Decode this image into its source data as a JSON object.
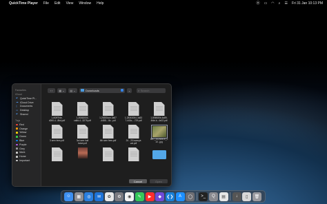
{
  "menubar": {
    "app_name": "QuickTime Player",
    "items": [
      "File",
      "Edit",
      "View",
      "Window",
      "Help"
    ],
    "datetime": "Fri 31 Jan  10:13 PM"
  },
  "dialog": {
    "sidebar": {
      "favourites_label": "Favourites",
      "icloud_label": "iCloud",
      "icloud_items": [
        "QuickTime Pl...",
        "iCloud Drive",
        "Documents",
        "Desktop",
        "Shared"
      ],
      "tags_label": "Tags",
      "tags": [
        {
          "label": "Red",
          "color": "#ff453a"
        },
        {
          "label": "Orange",
          "color": "#ff9f0a"
        },
        {
          "label": "Yellow",
          "color": "#ffd60a"
        },
        {
          "label": "Green",
          "color": "#32d74b"
        },
        {
          "label": "Blue",
          "color": "#0a84ff"
        },
        {
          "label": "Purple",
          "color": "#bf5af2"
        },
        {
          "label": "Grey",
          "color": "#98989d"
        },
        {
          "label": "Work",
          "color": "#d0d0d0"
        },
        {
          "label": "Home",
          "color": "#d0d0d0"
        },
        {
          "label": "Important",
          "color": "#d0d0d0"
        }
      ]
    },
    "location": "Downloads",
    "search_placeholder": "Search",
    "files": [
      {
        "name": "1-6f2ff7f4e-\nd260-4...8bd.pdf",
        "kind": "pdf"
      },
      {
        "name": "1-28363004-\nca8d-4...3278.pdf",
        "kind": "pdf"
      },
      {
        "name": "1-26350cce-3a57\n-4485-...8c...pdf",
        "kind": "pdf"
      },
      {
        "name": "1-28363004-3a53\n7-440c-...729.pdf",
        "kind": "pdf"
      },
      {
        "name": "1-8f3f680b-4a89-\n4fde-b...4e22.pdf",
        "kind": "pdf"
      },
      {
        "name": "3 sem fees.pdf",
        "kind": "pdf"
      },
      {
        "name": "3rd sem hall\nticket.pdf",
        "kind": "pdf"
      },
      {
        "name": "4th sem fees.pdf",
        "kind": "pdf"
      },
      {
        "name": "24 - 25 lavanya\nvat.pdf",
        "kind": "pdf"
      },
      {
        "name": "IMG_20240519_2\n10...jpg",
        "kind": "img"
      },
      {
        "name": "",
        "kind": "pdf"
      },
      {
        "name": "",
        "kind": "img2"
      },
      {
        "name": "",
        "kind": "pdf"
      },
      {
        "name": "",
        "kind": "pdf"
      },
      {
        "name": "",
        "kind": "folder"
      }
    ],
    "cancel_label": "Cancel",
    "open_label": "Open"
  },
  "dock": {
    "apps": [
      {
        "name": "finder-icon",
        "color": "#3d8ff0",
        "glyph": "☺"
      },
      {
        "name": "launchpad-icon",
        "color": "#8e8e93",
        "glyph": "▦"
      },
      {
        "name": "safari-icon",
        "color": "#2a7fe0",
        "glyph": "◎"
      },
      {
        "name": "mail-icon",
        "color": "#1e73d8",
        "glyph": "✉"
      },
      {
        "name": "photos-icon",
        "color": "#e8e8e8",
        "glyph": "✿"
      },
      {
        "name": "settings-icon",
        "color": "#7a7a80",
        "glyph": "⚙"
      },
      {
        "name": "chrome-icon",
        "color": "#f2f2f2",
        "glyph": "◉"
      },
      {
        "name": "messages-icon",
        "color": "#34c759",
        "glyph": "✎"
      },
      {
        "name": "youtube-icon",
        "color": "#ff2d2d",
        "glyph": "▶"
      },
      {
        "name": "app-icon-purple",
        "color": "#6f4bd8",
        "glyph": "◆"
      },
      {
        "name": "vscode-icon",
        "color": "#1a7fd6",
        "glyph": "❮❯"
      },
      {
        "name": "app-store-icon",
        "color": "#1e90ff",
        "glyph": "A"
      },
      {
        "name": "system-icon",
        "color": "#6e6e73",
        "glyph": "◯"
      },
      {
        "name": "terminal-icon",
        "color": "#222",
        "glyph": ">_"
      },
      {
        "name": "quicktime-icon",
        "color": "#8a8a8f",
        "glyph": "Q"
      },
      {
        "name": "preview-icon",
        "color": "#e6e6e6",
        "glyph": "▤"
      },
      {
        "name": "downloads-icon",
        "color": "#555",
        "glyph": "↓"
      },
      {
        "name": "document-icon",
        "color": "#d8d8d8",
        "glyph": "▯"
      },
      {
        "name": "trash-icon",
        "color": "#9a9a9f",
        "glyph": "🗑"
      }
    ]
  }
}
